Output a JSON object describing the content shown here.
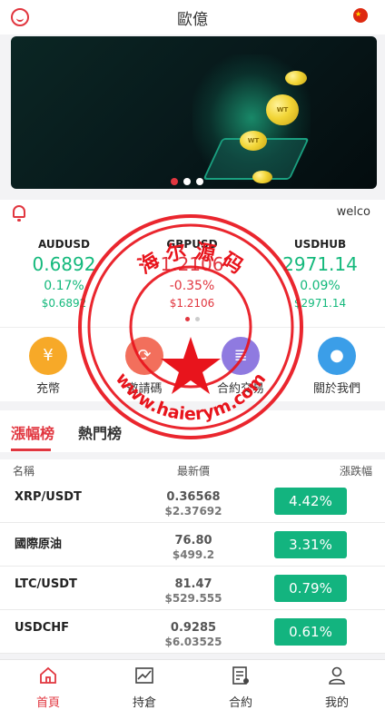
{
  "header": {
    "title": "歐億"
  },
  "notice": {
    "text": "welco"
  },
  "markets": [
    {
      "symbol": "AUDUSD",
      "price": "0.6892",
      "change": "0.17%",
      "sub": "$0.6892",
      "trend": "up"
    },
    {
      "symbol": "GBPUSD",
      "price": "1.2106",
      "change": "-0.35%",
      "sub": "$1.2106",
      "trend": "down"
    },
    {
      "symbol": "USDHUB",
      "price": "2971.14",
      "change": "0.09%",
      "sub": "$2971.14",
      "trend": "up"
    }
  ],
  "menu": [
    {
      "label": "充幣",
      "icon": "yuan-coin-icon",
      "color": "#f7a928"
    },
    {
      "label": "邀請碼",
      "icon": "refresh-icon",
      "color": "#f26f5c"
    },
    {
      "label": "合約交易",
      "icon": "document-icon",
      "color": "#8f7ae0"
    },
    {
      "label": "關於我們",
      "icon": "users-icon",
      "color": "#3b9ee8"
    }
  ],
  "tabs": [
    "漲幅榜",
    "熱門榜"
  ],
  "table": {
    "headers": {
      "name": "名稱",
      "price": "最新價",
      "change": "漲跌幅"
    },
    "rows": [
      {
        "name": "XRP/USDT",
        "price": "0.36568",
        "price_usd": "$2.37692",
        "change": "4.42%"
      },
      {
        "name": "國際原油",
        "price": "76.80",
        "price_usd": "$499.2",
        "change": "3.31%"
      },
      {
        "name": "LTC/USDT",
        "price": "81.47",
        "price_usd": "$529.555",
        "change": "0.79%"
      },
      {
        "name": "USDCHF",
        "price": "0.9285",
        "price_usd": "$6.03525",
        "change": "0.61%"
      }
    ]
  },
  "tabbar": [
    {
      "label": "首頁",
      "icon": "home-icon",
      "active": true
    },
    {
      "label": "持倉",
      "icon": "chart-icon",
      "active": false
    },
    {
      "label": "合約",
      "icon": "contract-icon",
      "active": false
    },
    {
      "label": "我的",
      "icon": "user-icon",
      "active": false
    }
  ],
  "watermark": {
    "top_text": "海 尔 源 码",
    "bottom_text": "www.haierym.com"
  },
  "colors": {
    "accent": "#e1363f",
    "up": "#14b97c",
    "badge": "#13b47f"
  }
}
